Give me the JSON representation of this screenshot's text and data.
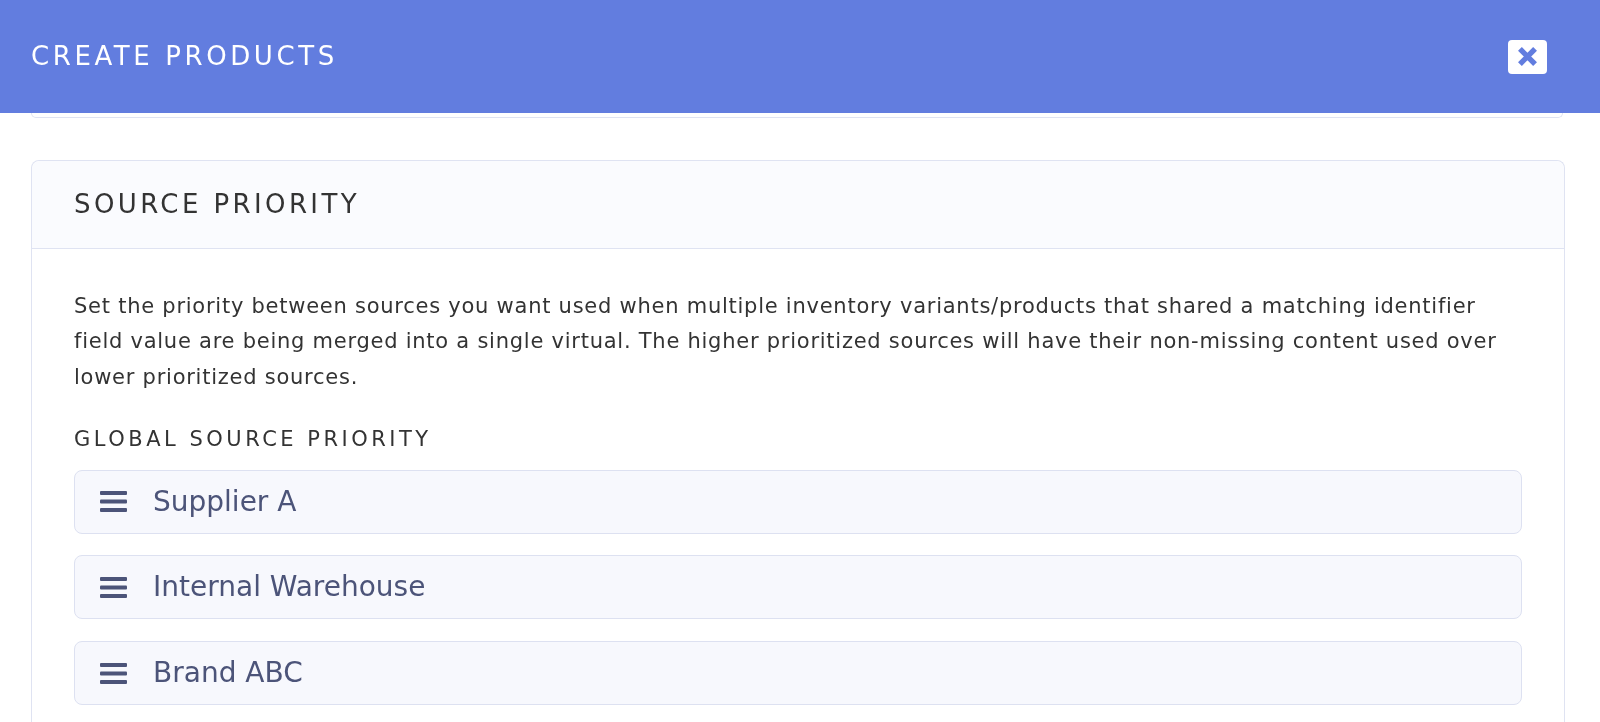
{
  "dialog": {
    "title": "CREATE PRODUCTS"
  },
  "section": {
    "title": "SOURCE PRIORITY",
    "description": "Set the priority between sources you want used when multiple inventory variants/products that shared a matching identifier field value are being merged into a single virtual. The higher prioritized sources will have their non-missing content used over lower prioritized sources.",
    "list_label": "GLOBAL SOURCE PRIORITY",
    "sources": [
      "Supplier A",
      "Internal Warehouse",
      "Brand ABC"
    ]
  }
}
